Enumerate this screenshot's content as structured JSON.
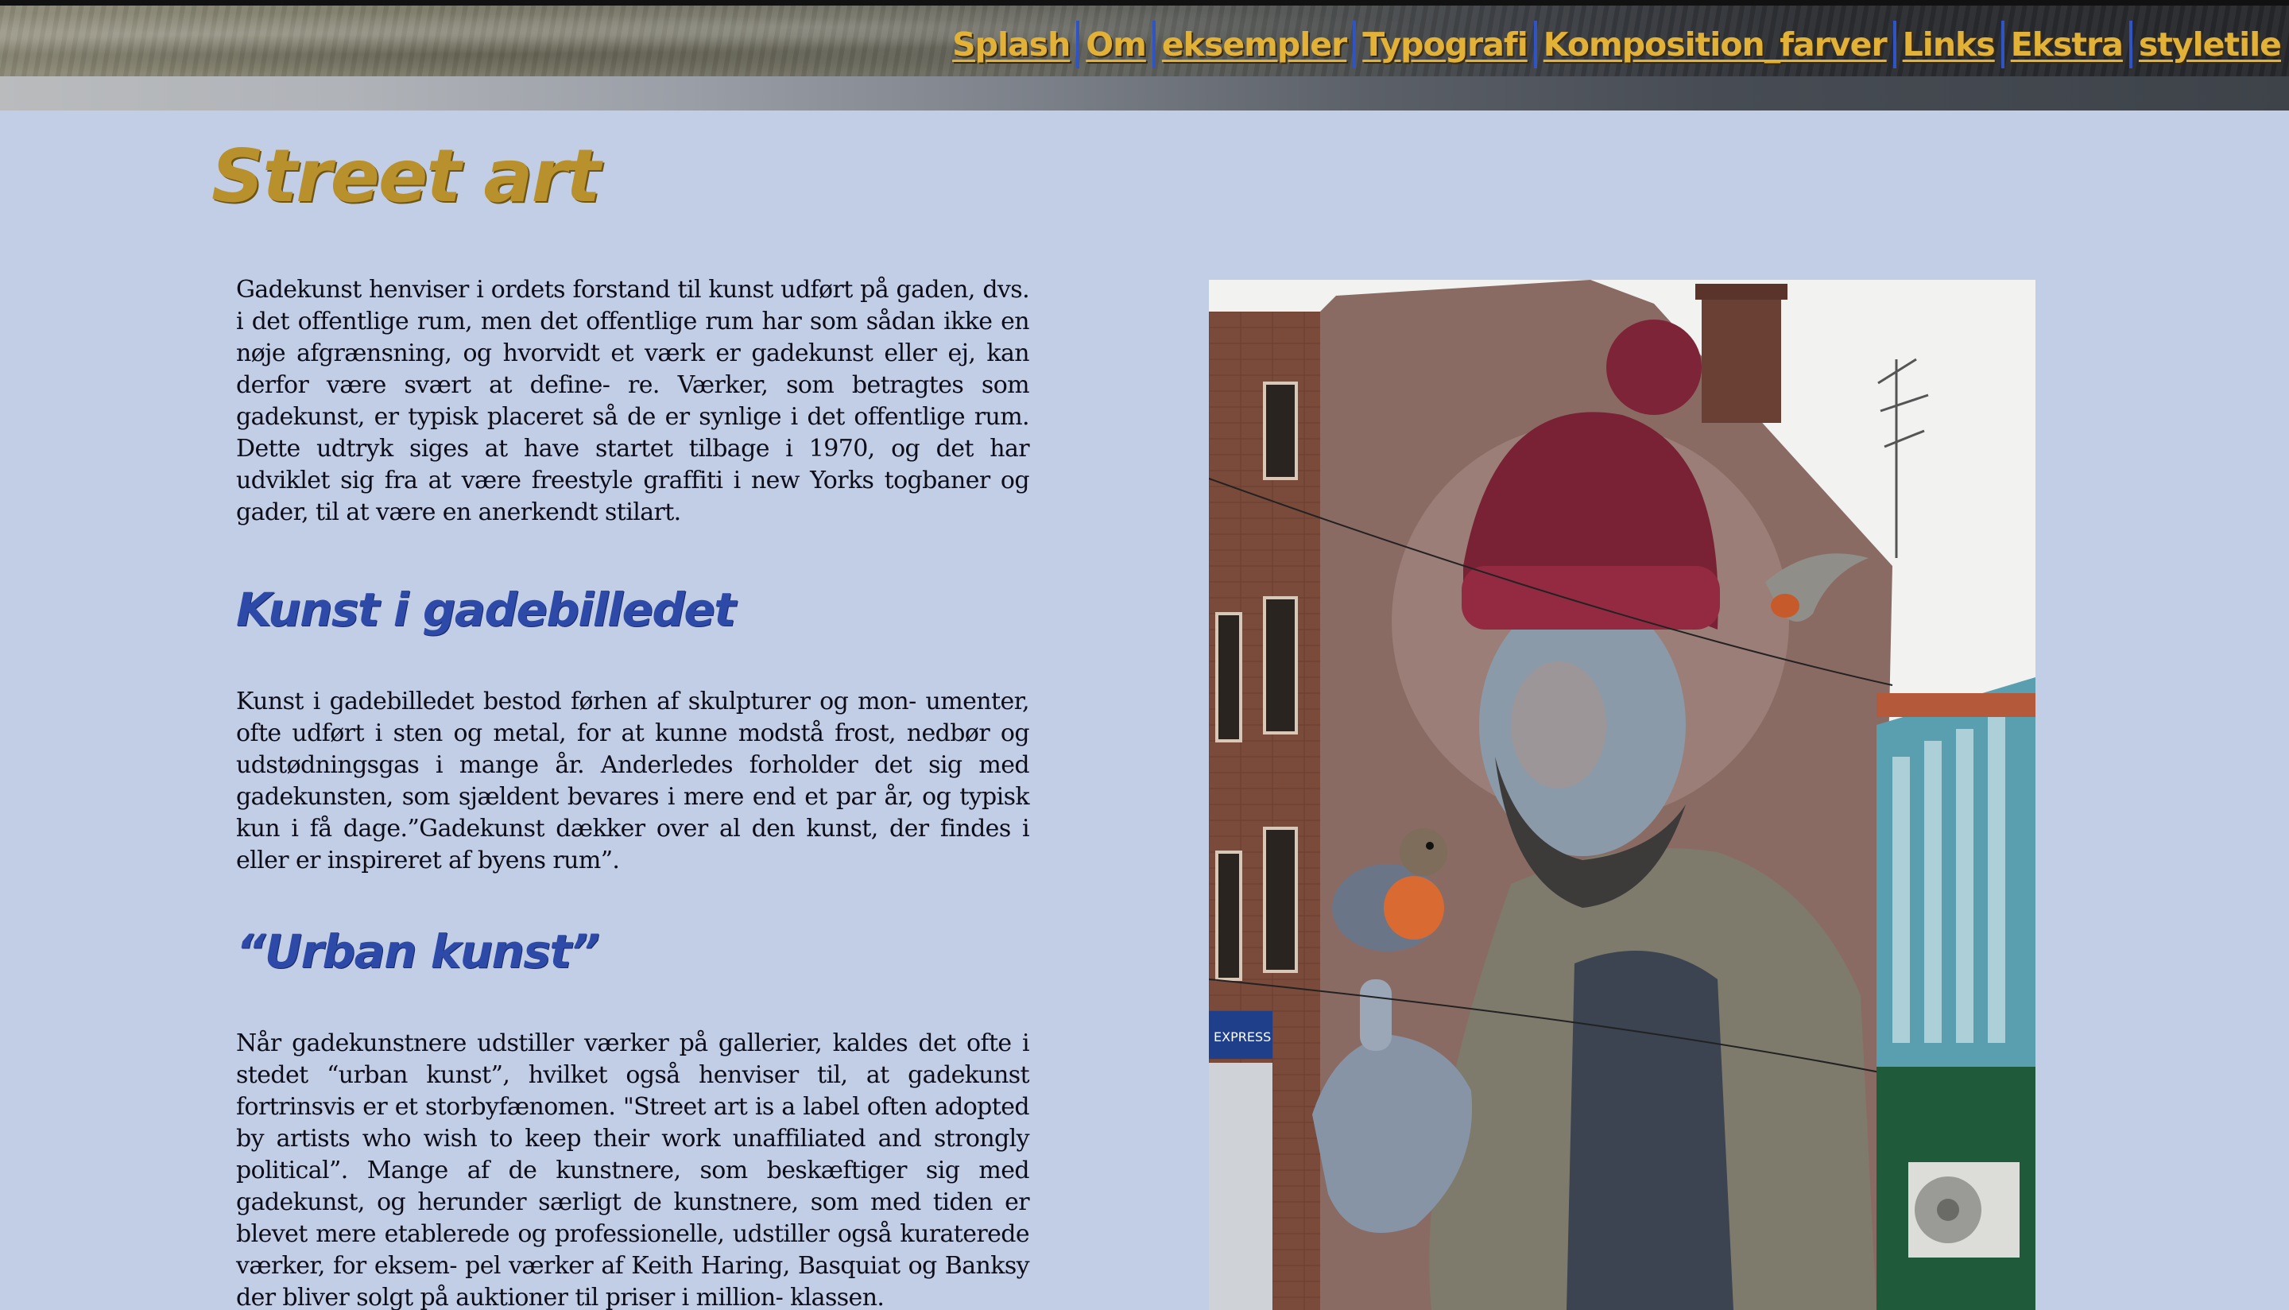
{
  "nav": {
    "items": [
      {
        "label": "Splash"
      },
      {
        "label": "Om"
      },
      {
        "label": "eksempler"
      },
      {
        "label": "Typografi"
      },
      {
        "label": "Komposition_farver"
      },
      {
        "label": "Links"
      },
      {
        "label": "Ekstra"
      },
      {
        "label": "styletile"
      }
    ]
  },
  "page": {
    "title": "Street art"
  },
  "sections": {
    "intro": "Gadekunst henviser i ordets forstand til kunst udført på gaden, dvs. i det offentlige rum, men det offentlige rum har som sådan ikke en nøje afgrænsning, og hvorvidt et værk er gadekunst eller ej, kan derfor være svært at define- re. Værker, som betragtes som gadekunst, er typisk placeret så de er synlige i det offentlige rum. Dette udtryk siges at have startet tilbage i 1970, og det har udviklet sig fra at være freestyle graffiti i new Yorks togbaner og gader, til at være en anerkendt stilart.",
    "heading1": "Kunst i gadebilledet",
    "para1": "Kunst i gadebilledet bestod førhen af skulpturer og mon- umenter, ofte udført i sten og metal, for at kunne modstå frost, nedbør og udstødningsgas i mange år. Anderledes forholder det sig med gadekunsten, som sjældent bevares i mere end et par år, og typisk kun i få dage.”Gadekunst dækker over al den kunst, der findes i eller er inspireret af byens rum”.",
    "heading2": "“Urban kunst”",
    "para2": "Når gadekunstnere udstiller værker på gallerier, kaldes det ofte i stedet “urban kunst”, hvilket også henviser til, at gadekunst fortrinsvis er et storbyfænomen. \"Street art is a label often adopted by artists who wish to keep their work unaffiliated and strongly political”. Mange af de kunstnere, som beskæftiger sig med gadekunst, og herunder særligt de kunstnere, som med tiden er blevet mere etablerede og professionelle, udstiller også kuraterede værker, for eksem- pel værker af Keith Haring, Basquiat og Banksy der bliver solgt på auktioner til priser i million- klassen."
  },
  "image": {
    "signage": "EXPRESS"
  },
  "colors": {
    "accent_gold": "#e2b238",
    "title_gold": "#b8902c",
    "heading_blue": "#2d4aa8",
    "nav_separator": "#2f54c8",
    "page_background": "#c2cde6"
  }
}
